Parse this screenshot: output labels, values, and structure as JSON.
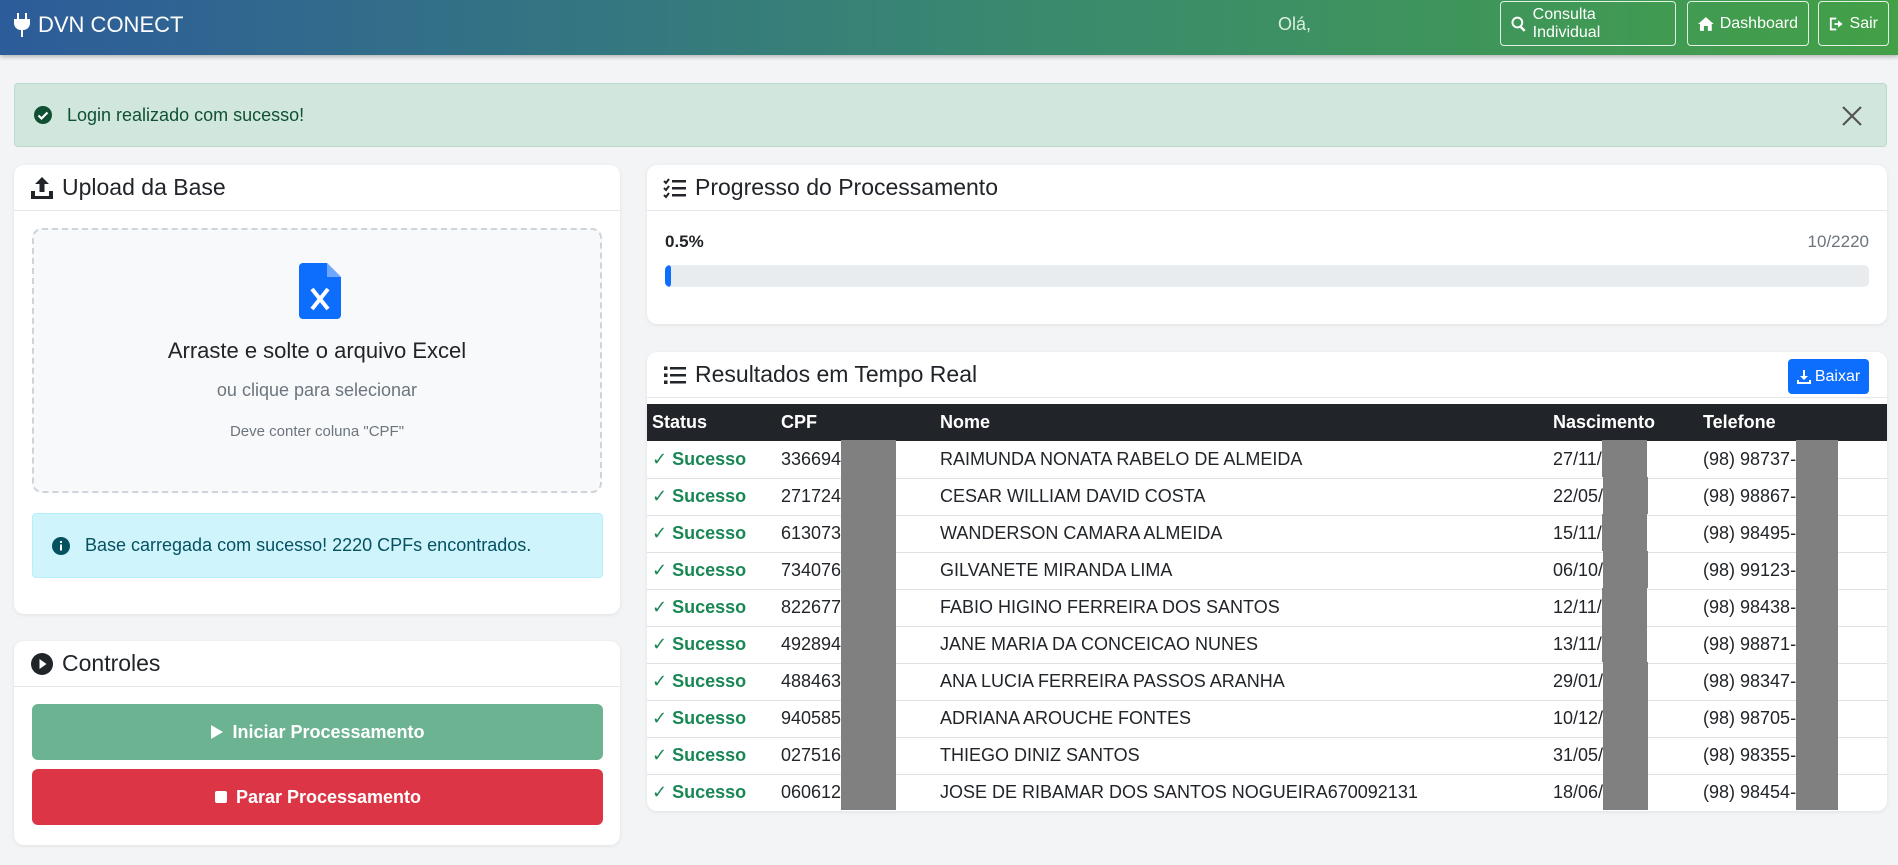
{
  "nav": {
    "brand": "DVN CONECT",
    "greeting": "Olá,",
    "buttons": {
      "consulta": "Consulta Individual",
      "dashboard": "Dashboard",
      "sair": "Sair"
    }
  },
  "alert_success": {
    "text": "Login realizado com sucesso!"
  },
  "upload": {
    "title": "Upload da Base",
    "drop_title": "Arraste e solte o arquivo Excel",
    "drop_sub": "ou clique para selecionar",
    "drop_note": "Deve conter coluna \"CPF\"",
    "info": "Base carregada com sucesso! 2220 CPFs encontrados."
  },
  "controls": {
    "title": "Controles",
    "start": "Iniciar Processamento",
    "stop": "Parar Processamento"
  },
  "progress": {
    "title": "Progresso do Processamento",
    "percent_label": "0.5%",
    "count_label": "10/2220",
    "fraction": 0.005
  },
  "results": {
    "title": "Resultados em Tempo Real",
    "download": "Baixar",
    "columns": [
      "Status",
      "CPF",
      "Nome",
      "Nascimento",
      "Telefone"
    ],
    "rows": [
      {
        "status": "✓ Sucesso",
        "cpf": "336694",
        "nome": "RAIMUNDA NONATA RABELO DE ALMEIDA",
        "nasc": "27/11/",
        "tel": "(98) 98737-"
      },
      {
        "status": "✓ Sucesso",
        "cpf": "271724",
        "nome": "CESAR WILLIAM DAVID COSTA",
        "nasc": "22/05/",
        "tel": "(98) 98867-"
      },
      {
        "status": "✓ Sucesso",
        "cpf": "613073",
        "nome": "WANDERSON CAMARA ALMEIDA",
        "nasc": "15/11/",
        "tel": "(98) 98495-"
      },
      {
        "status": "✓ Sucesso",
        "cpf": "734076",
        "nome": "GILVANETE MIRANDA LIMA",
        "nasc": "06/10/",
        "tel": "(98) 99123-"
      },
      {
        "status": "✓ Sucesso",
        "cpf": "822677",
        "nome": "FABIO HIGINO FERREIRA DOS SANTOS",
        "nasc": "12/11/",
        "tel": "(98) 98438-"
      },
      {
        "status": "✓ Sucesso",
        "cpf": "492894",
        "nome": "JANE MARIA DA CONCEICAO NUNES",
        "nasc": "13/11/",
        "tel": "(98) 98871-"
      },
      {
        "status": "✓ Sucesso",
        "cpf": "488463",
        "nome": "ANA LUCIA FERREIRA PASSOS ARANHA",
        "nasc": "29/01/",
        "tel": "(98) 98347-"
      },
      {
        "status": "✓ Sucesso",
        "cpf": "940585",
        "nome": "ADRIANA AROUCHE FONTES",
        "nasc": "10/12/",
        "tel": "(98) 98705-"
      },
      {
        "status": "✓ Sucesso",
        "cpf": "027516",
        "nome": "THIEGO DINIZ SANTOS",
        "nasc": "31/05/",
        "tel": "(98) 98355-"
      },
      {
        "status": "✓ Sucesso",
        "cpf": "060612",
        "nome": "JOSE DE RIBAMAR DOS SANTOS NOGUEIRA670092131",
        "nasc": "18/06/",
        "tel": "(98) 98454-"
      }
    ]
  }
}
